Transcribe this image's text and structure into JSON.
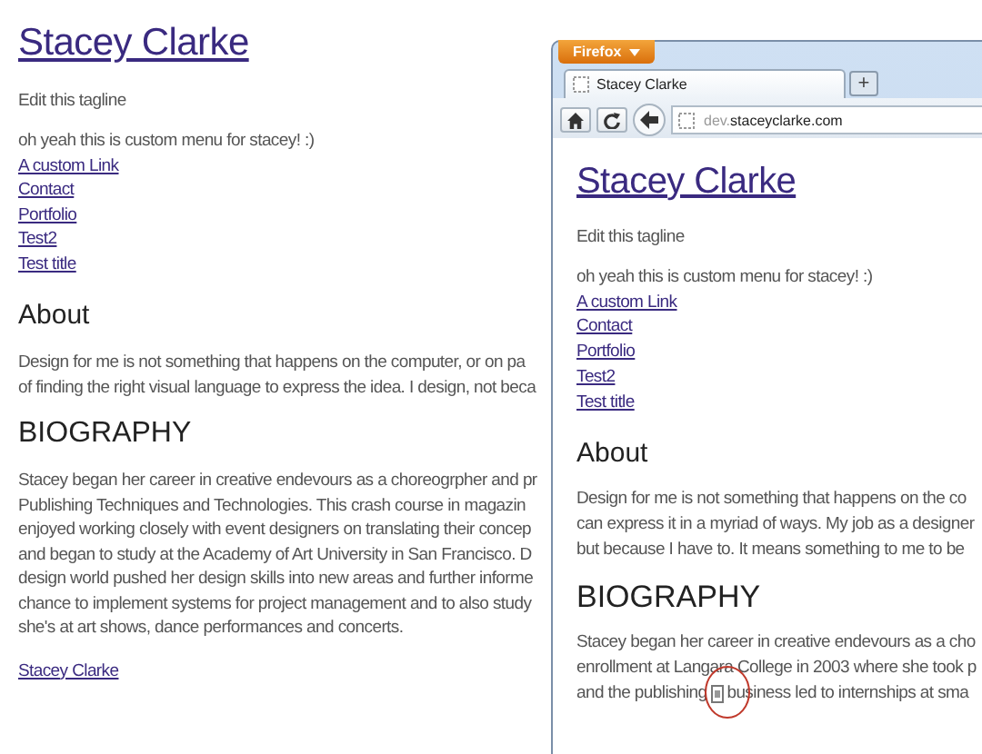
{
  "page": {
    "title": "Stacey Clarke",
    "tagline": "Edit this tagline",
    "menu_intro": "oh yeah this is custom menu for stacey! :)",
    "menu_links": [
      "A custom Link",
      "Contact",
      "Portfolio",
      "Test2",
      "Test title"
    ],
    "about_heading": "About",
    "about_lines": [
      "Design for me is not something that happens on the computer, or on pa",
      "of finding the right visual language to express the idea. I design, not beca"
    ],
    "bio_heading": "BIOGRAPHY",
    "bio_lines": [
      "Stacey began her career in creative endevours as a choreogrpher and pr",
      "Publishing Techniques and Technologies. This crash course in magazin",
      "enjoyed working closely with event designers on translating their concep",
      "and began to study at the Academy of Art University in San Francisco. D",
      "design world pushed her design skills into new areas and further informe",
      "chance to implement systems for project management and to also study",
      "she's at art shows, dance performances and concerts."
    ],
    "footer_link": "Stacey Clarke"
  },
  "browser": {
    "app_button": "Firefox",
    "tab_title": "Stacey Clarke",
    "new_tab": "+",
    "url_prefix": "dev.",
    "url_domain": "staceyclarke.com",
    "page": {
      "title": "Stacey Clarke",
      "tagline": "Edit this tagline",
      "menu_intro": "oh yeah this is custom menu for stacey! :)",
      "menu_links": [
        "A custom Link",
        "Contact",
        "Portfolio",
        "Test2",
        "Test title"
      ],
      "about_heading": "About",
      "about_lines": [
        "Design for me is not something that happens on the co",
        "can express it in a myriad of ways. My job as a designer",
        "but because I have to. It means something to me to be"
      ],
      "bio_heading": "BIOGRAPHY",
      "bio_lines": [
        "Stacey began her career in creative endevours as a cho",
        "enrollment at Langara College in 2003 where she took p"
      ],
      "bio_last_before": "and the publishing",
      "bio_last_after": "business led to internships at sma"
    }
  }
}
